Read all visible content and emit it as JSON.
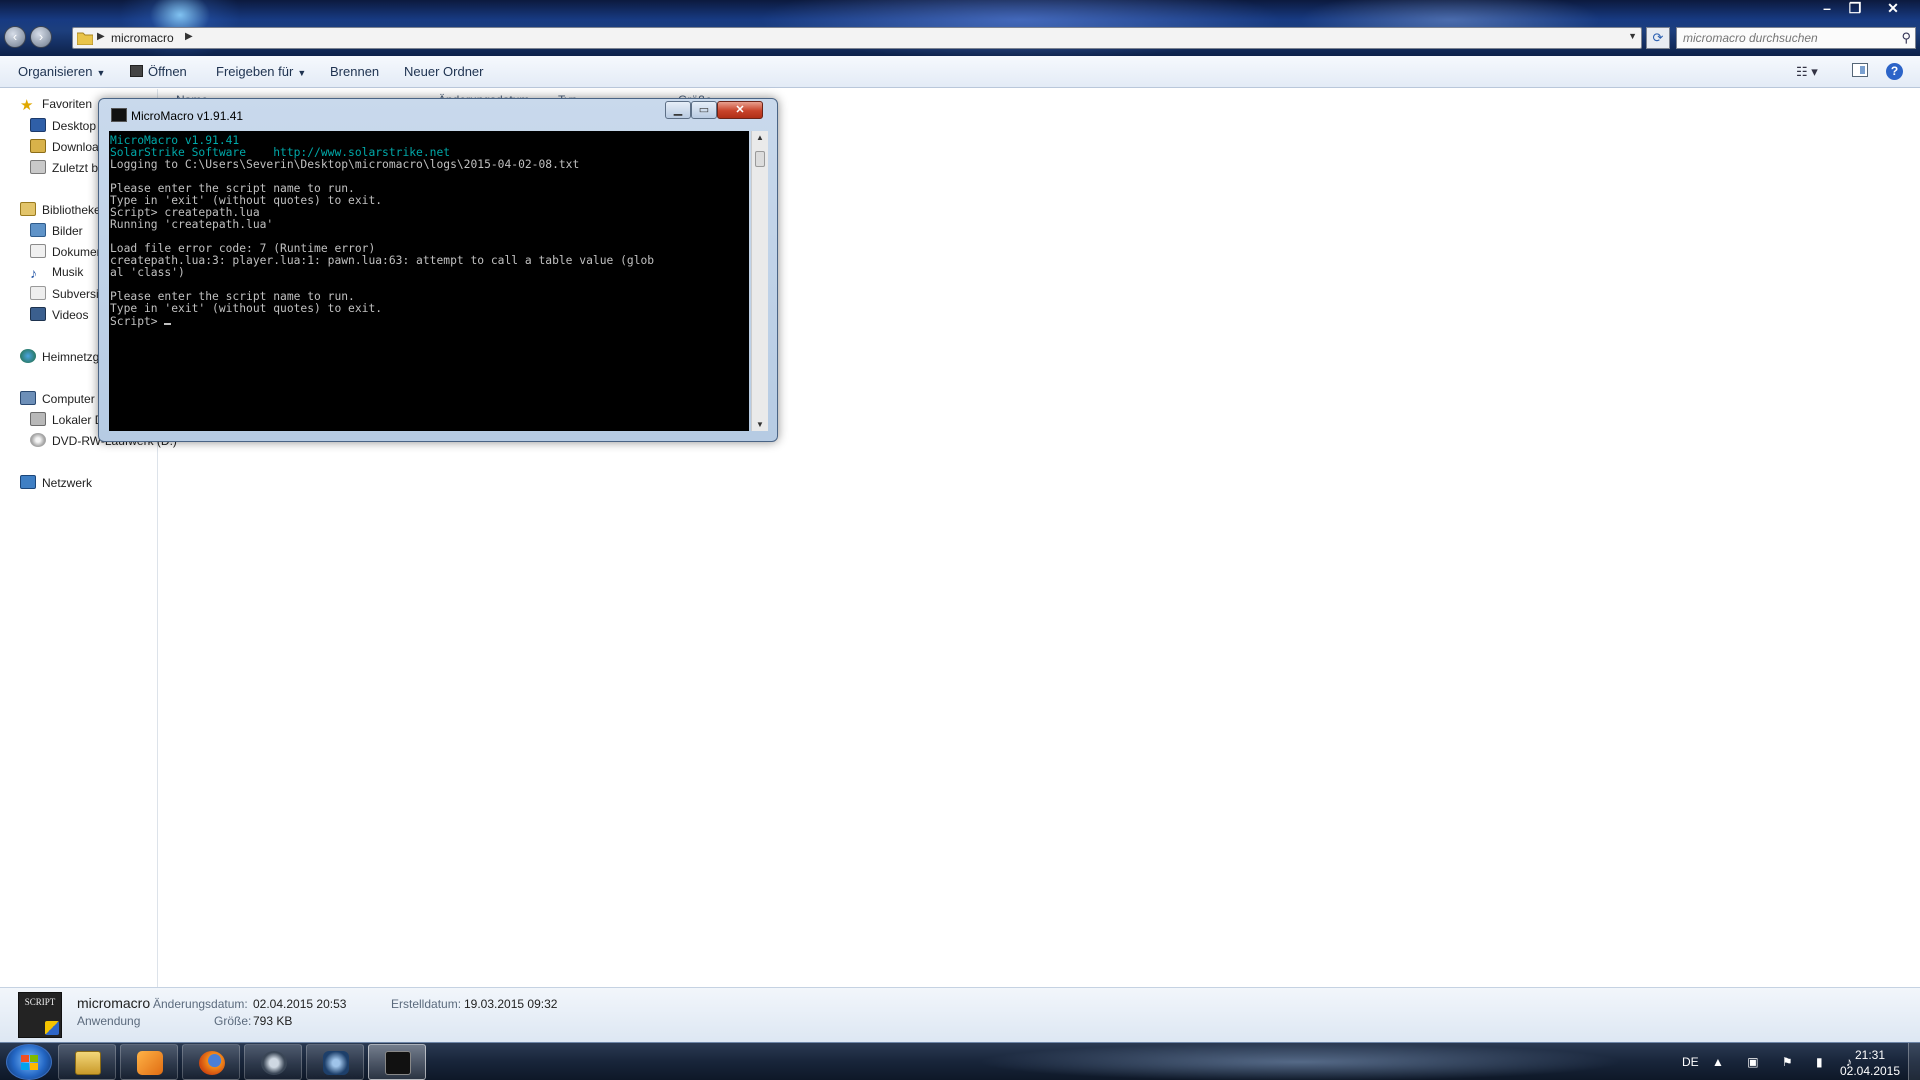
{
  "explorer": {
    "address_crumb": "micromacro",
    "search_placeholder": "micromacro durchsuchen"
  },
  "toolbar": {
    "organisieren": "Organisieren",
    "oeffnen": "Öffnen",
    "freigeben": "Freigeben für",
    "brennen": "Brennen",
    "neuer_ordner": "Neuer Ordner"
  },
  "columns": [
    "Name",
    "Änderungsdatum",
    "Typ",
    "Größe"
  ],
  "nav": {
    "favoriten": "Favoriten",
    "desktop": "Desktop",
    "downloads": "Downloads",
    "zuletzt": "Zuletzt besucht",
    "bibliotheken": "Bibliotheken",
    "bilder": "Bilder",
    "dokumente": "Dokumente",
    "musik": "Musik",
    "subversion": "Subversion",
    "videos": "Videos",
    "heimnetz": "Heimnetzgruppe",
    "computer": "Computer",
    "lokaler": "Lokaler Datenträger (C:)",
    "dvd": "DVD-RW-Laufwerk (D:)",
    "netzwerk": "Netzwerk"
  },
  "details": {
    "thumb_text": "SCRIPT",
    "name": "micromacro",
    "type": "Anwendung",
    "mod_label": "Änderungsdatum:",
    "mod_value": "02.04.2015 20:53",
    "size_label": "Größe:",
    "size_value": "793 KB",
    "created_label": "Erstelldatum:",
    "created_value": "19.03.2015 09:32"
  },
  "console": {
    "title": "MicroMacro v1.91.41",
    "lines": [
      "MicroMacro v1.91.41",
      "SolarStrike Software    http://www.solarstrike.net",
      "Logging to C:\\Users\\Severin\\Desktop\\micromacro\\logs\\2015-04-02-08.txt",
      "",
      "Please enter the script name to run.",
      "Type in 'exit' (without quotes) to exit.",
      "Script> createpath.lua",
      "Running 'createpath.lua'",
      "",
      "Load file error code: 7 (Runtime error)",
      "createpath.lua:3: player.lua:1: pawn.lua:63: attempt to call a table value (glob",
      "al 'class')",
      "",
      "Please enter the script name to run.",
      "Type in 'exit' (without quotes) to exit.",
      "Script> "
    ]
  },
  "tray": {
    "lang": "DE",
    "time": "21:31",
    "date": "02.04.2015"
  },
  "colors": {
    "console_bg": "#000000",
    "console_text": "#c0c0c0",
    "console_cyan": "#00a8a8",
    "close_red": "#c8432a"
  }
}
